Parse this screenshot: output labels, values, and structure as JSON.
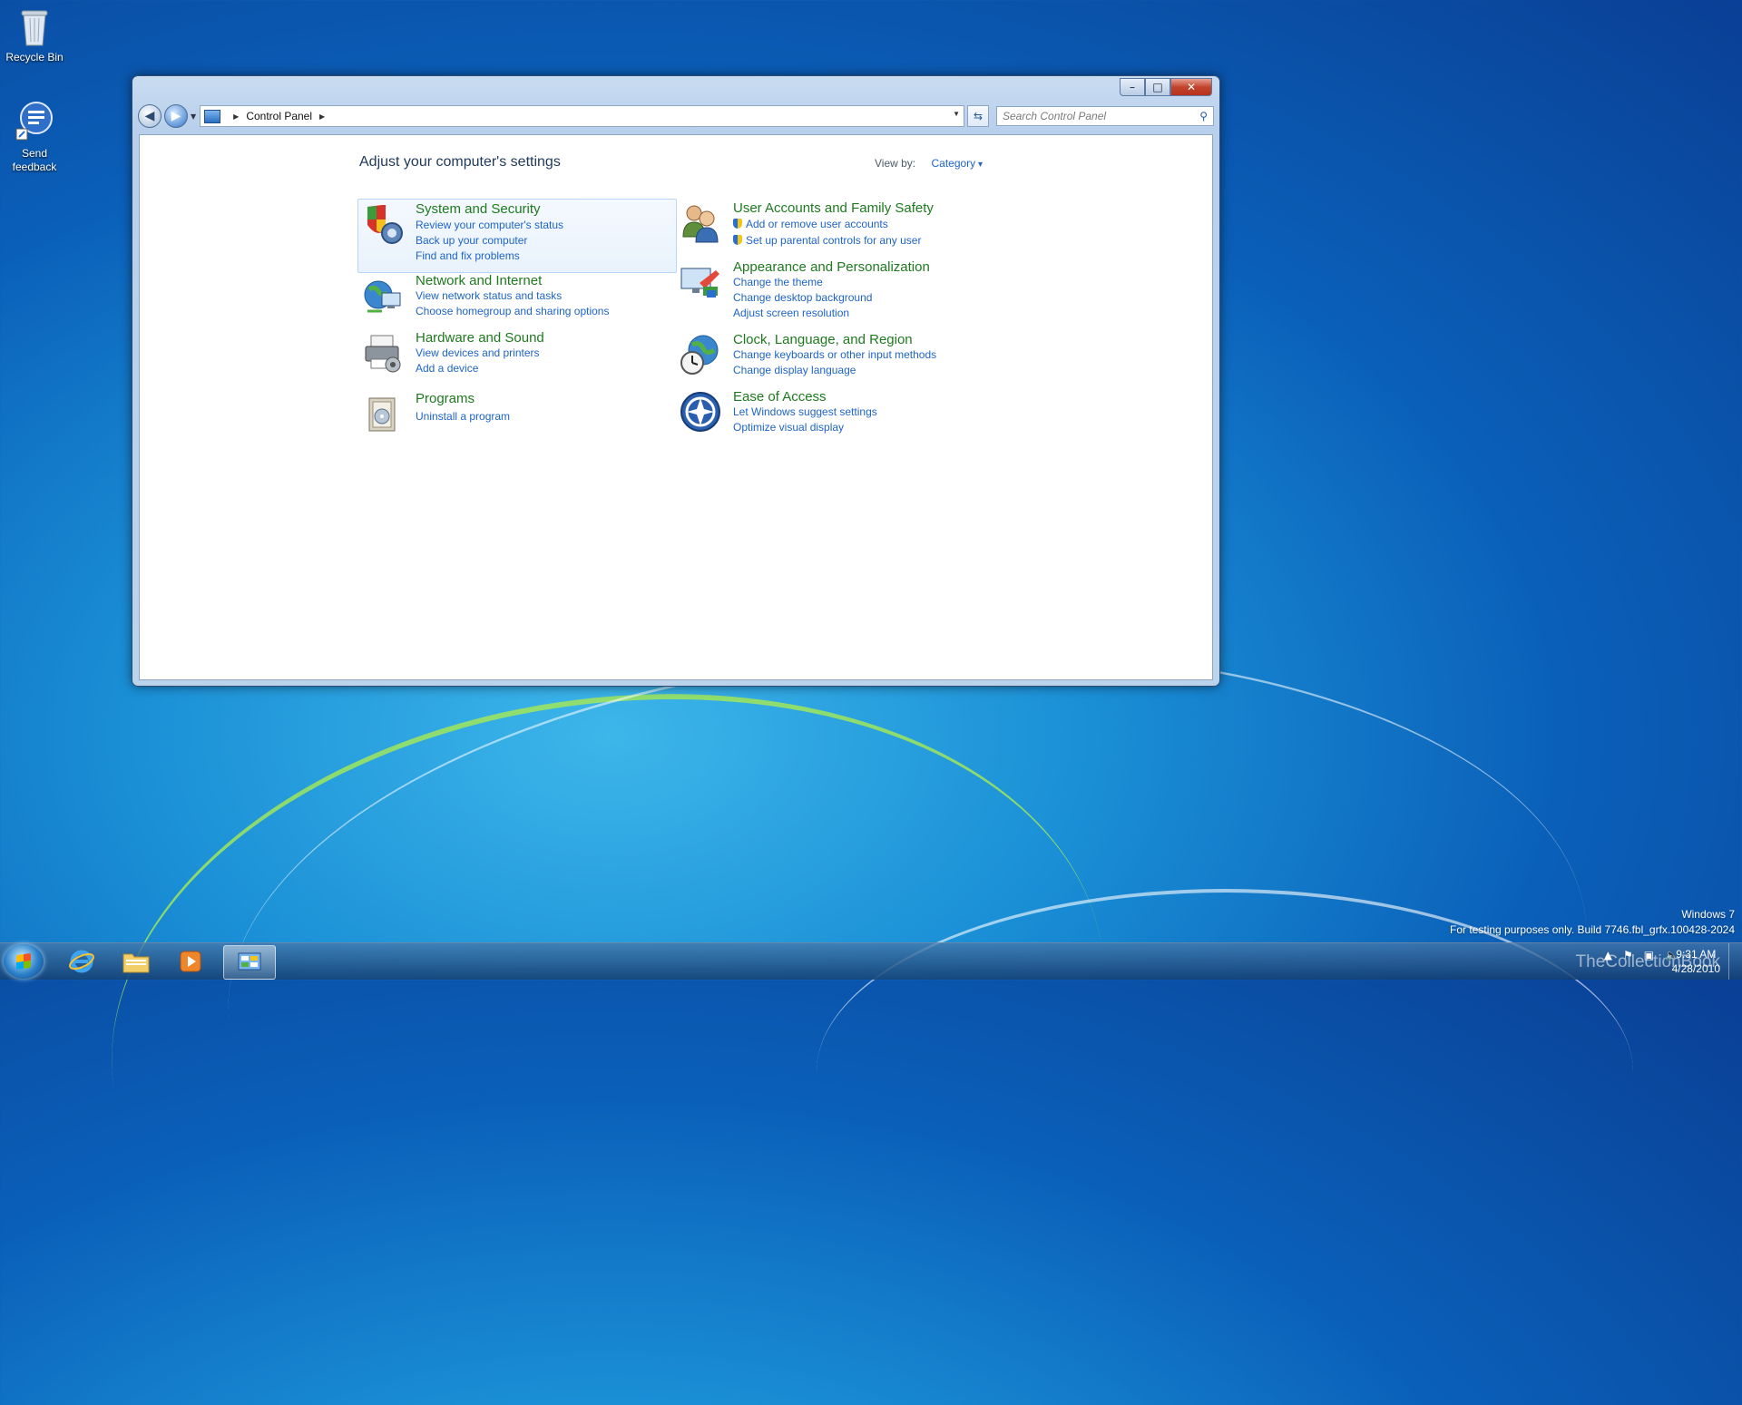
{
  "desktop": {
    "icons": [
      {
        "label": "Recycle Bin"
      },
      {
        "label": "Send feedback"
      }
    ]
  },
  "window": {
    "title_buttons": {
      "minimize": "–",
      "maximize": "□",
      "close": "✕"
    },
    "address": {
      "root": "Control Panel"
    },
    "search_placeholder": "Search Control Panel",
    "heading": "Adjust your computer's settings",
    "view_by_label": "View by:",
    "view_by_value": "Category",
    "categories_left": [
      {
        "title": "System and Security",
        "links": [
          "Review your computer's status",
          "Back up your computer",
          "Find and fix problems"
        ]
      },
      {
        "title": "Network and Internet",
        "links": [
          "View network status and tasks",
          "Choose homegroup and sharing options"
        ]
      },
      {
        "title": "Hardware and Sound",
        "links": [
          "View devices and printers",
          "Add a device"
        ]
      },
      {
        "title": "Programs",
        "links": [
          "Uninstall a program"
        ]
      }
    ],
    "categories_right": [
      {
        "title": "User Accounts and Family Safety",
        "links": [
          "Add or remove user accounts",
          "Set up parental controls for any user"
        ]
      },
      {
        "title": "Appearance and Personalization",
        "links": [
          "Change the theme",
          "Change desktop background",
          "Adjust screen resolution"
        ]
      },
      {
        "title": "Clock, Language, and Region",
        "links": [
          "Change keyboards or other input methods",
          "Change display language"
        ]
      },
      {
        "title": "Ease of Access",
        "links": [
          "Let Windows suggest settings",
          "Optimize visual display"
        ]
      }
    ]
  },
  "taskbar": {
    "clock_time": "9:31 AM",
    "clock_date": "4/28/2010"
  },
  "watermark": {
    "line1": "Windows 7",
    "line2": "For testing purposes only. Build 7746.fbl_grfx.100428-2024",
    "collection": "TheCollectionBook"
  },
  "colors": {
    "link": "#1e64c8",
    "category_title": "#1e7a1e",
    "heading": "#1e395b"
  }
}
